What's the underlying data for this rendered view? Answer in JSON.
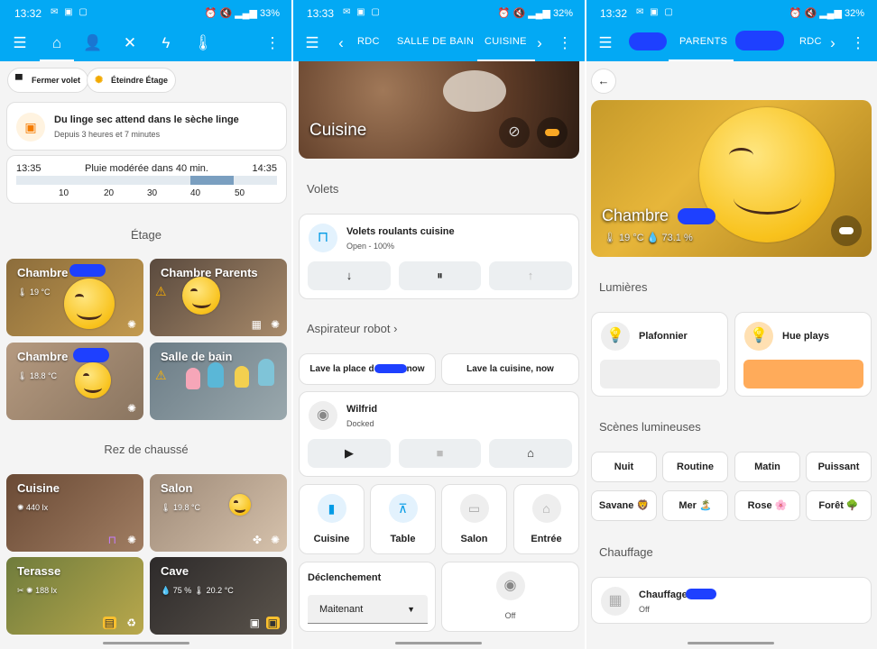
{
  "panel1": {
    "status": {
      "time": "13:32",
      "battery": "33%"
    },
    "chips": [
      {
        "label": "Fermer volet"
      },
      {
        "label": "Éteindre Étage"
      }
    ],
    "notification": {
      "title": "Du linge sec attend dans le sèche linge",
      "subtitle": "Depuis 3 heures et 7 minutes"
    },
    "rain": {
      "start": "13:35",
      "text": "Pluie modérée dans 40 min.",
      "end": "14:35",
      "ticks": [
        "10",
        "20",
        "30",
        "40",
        "50"
      ],
      "highlight_from_min": 40,
      "highlight_to_min": 50
    },
    "sections": {
      "floor": "Étage",
      "ground": "Rez de chaussé"
    },
    "rooms": [
      {
        "name": "Chambre",
        "sub": "19 °C"
      },
      {
        "name": "Chambre Parents",
        "sub": ""
      },
      {
        "name": "Chambre",
        "sub": "18.8 °C"
      },
      {
        "name": "Salle de bain",
        "sub": ""
      },
      {
        "name": "Cuisine",
        "sub": "440 lx"
      },
      {
        "name": "Salon",
        "sub": "19.8 °C"
      },
      {
        "name": "Terasse",
        "sub": "188 lx"
      },
      {
        "name": "Cave",
        "sub": "75 %",
        "sub2": "20.2 °C"
      }
    ]
  },
  "panel2": {
    "status": {
      "time": "13:33",
      "battery": "32%"
    },
    "tabs": [
      "RDC",
      "SALLE DE BAIN",
      "CUISINE"
    ],
    "hero_title": "Cuisine",
    "volets": {
      "section": "Volets",
      "title": "Volets roulants cuisine",
      "state": "Open - 100%"
    },
    "robot": {
      "section": "Aspirateur robot",
      "chip1": "Lave la place d",
      "chip1_end": "now",
      "chip2": "Lave la cuisine, now",
      "name": "Wilfrid",
      "state": "Docked"
    },
    "tiles": [
      "Cuisine",
      "Table",
      "Salon",
      "Entrée"
    ],
    "trigger": {
      "title": "Déclenchement",
      "value": "Maitenant",
      "state": "Off"
    }
  },
  "panel3": {
    "status": {
      "time": "13:32",
      "battery": "32%"
    },
    "tabs": [
      "PARENTS",
      "RDC"
    ],
    "hero": {
      "title": "Chambre",
      "temp": "19 °C",
      "humidity": "73.1 %"
    },
    "lights": {
      "section": "Lumières",
      "items": [
        {
          "name": "Plafonnier"
        },
        {
          "name": "Hue plays"
        }
      ]
    },
    "scenes": {
      "section": "Scènes lumineuses",
      "items": [
        "Nuit",
        "Routine",
        "Matin",
        "Puissant",
        "Savane 🦁",
        "Mer 🏝️",
        "Rose 🌸",
        "Forêt 🌳"
      ]
    },
    "heating": {
      "section": "Chauffage",
      "name": "Chauffage",
      "state": "Off"
    }
  }
}
